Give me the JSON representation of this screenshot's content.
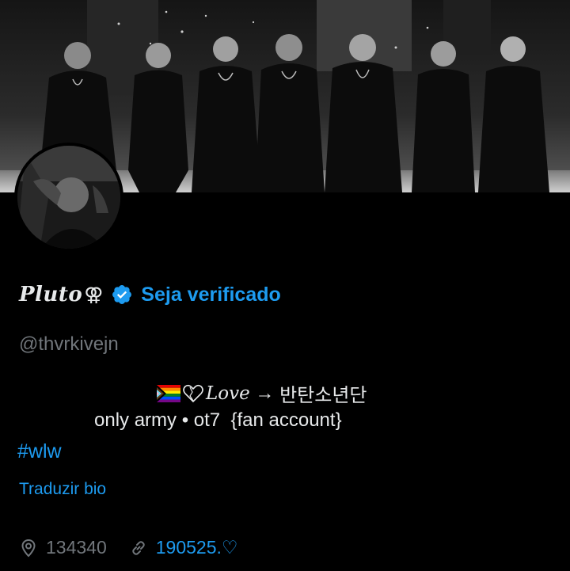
{
  "profile": {
    "display_name": "Pluto",
    "name_symbol": "⚢",
    "verify_label": "Seja verificado",
    "handle": "@thvrkivejn",
    "bio": {
      "line1_love": "Love",
      "line1_arrow": " → ",
      "line1_korean": "반탄소년단",
      "line2": "only army • ot7  {fan account}"
    },
    "hashtag": "#wlw",
    "translate_label": "Traduzir bio",
    "location": "134340",
    "link": "190525.♡"
  },
  "icons": {
    "verified": "verified-badge-icon",
    "flag": "progress-pride-flag-icon",
    "heart": "heart-icon",
    "location": "location-pin-icon",
    "link": "link-icon"
  },
  "colors": {
    "background": "#000000",
    "text_primary": "#e7e9ea",
    "text_secondary": "#71767b",
    "accent": "#1d9bf0"
  }
}
